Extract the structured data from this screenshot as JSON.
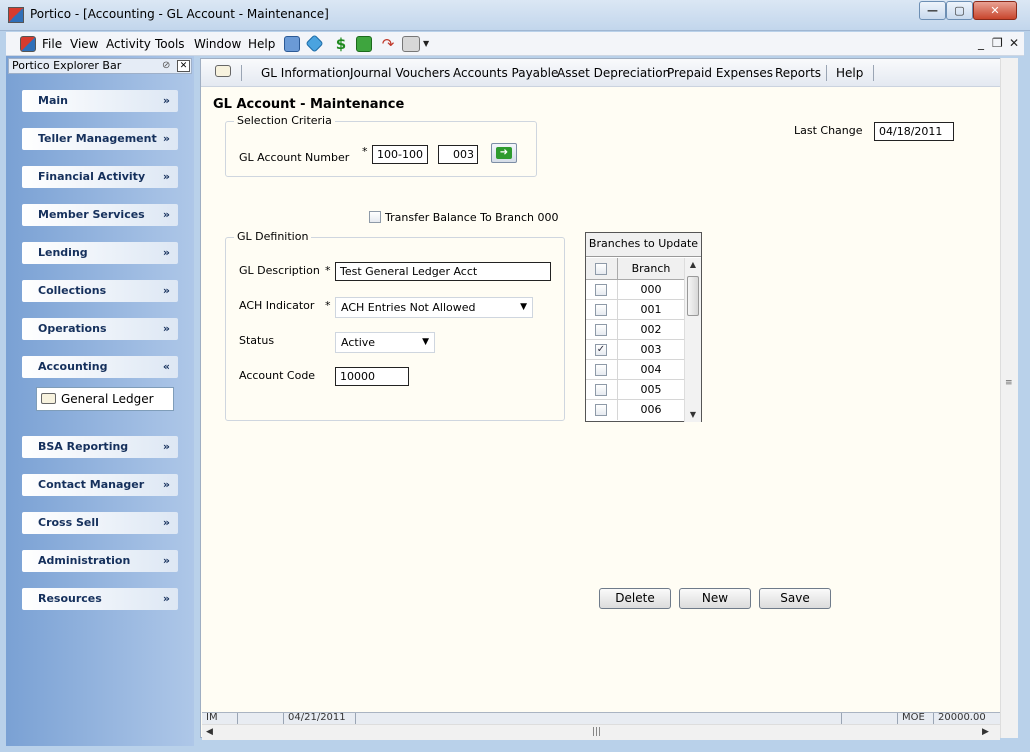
{
  "window": {
    "title": "Portico - [Accounting - GL Account - Maintenance]",
    "min": "—",
    "max": "▢",
    "close": "✕"
  },
  "menu": {
    "items": [
      "File",
      "View",
      "Activity",
      "Tools",
      "Window",
      "Help"
    ],
    "mdi_min": "_",
    "mdi_restore": "❐",
    "mdi_close": "✕"
  },
  "explorer": {
    "title": "Portico Explorer Bar",
    "sections": [
      {
        "label": "Main",
        "chev": "»"
      },
      {
        "label": "Teller Management",
        "chev": "»"
      },
      {
        "label": "Financial Activity",
        "chev": "»"
      },
      {
        "label": "Member Services",
        "chev": "»"
      },
      {
        "label": "Lending",
        "chev": "»"
      },
      {
        "label": "Collections",
        "chev": "»"
      },
      {
        "label": "Operations",
        "chev": "»"
      },
      {
        "label": "Accounting",
        "chev": "«"
      },
      {
        "label": "BSA Reporting",
        "chev": "»"
      },
      {
        "label": "Contact Manager",
        "chev": "»"
      },
      {
        "label": "Cross Sell",
        "chev": "»"
      },
      {
        "label": "Administration",
        "chev": "»"
      },
      {
        "label": "Resources",
        "chev": "»"
      }
    ],
    "accounting_item": "General Ledger"
  },
  "subnav": {
    "items": [
      "GL Information",
      "Journal Vouchers",
      "Accounts Payable",
      "Asset Depreciation",
      "Prepaid Expenses",
      "Reports",
      "Help"
    ]
  },
  "page": {
    "title": "GL Account - Maintenance",
    "selection_legend": "Selection Criteria",
    "gl_account_label": "GL Account Number",
    "gl_account_number": "100-100",
    "gl_account_suffix": "003",
    "last_change_label": "Last Change",
    "last_change_value": "04/18/2011",
    "transfer_label": "Transfer Balance To Branch 000",
    "definition_legend": "GL Definition",
    "description_label": "GL Description",
    "description_value": "Test General Ledger Acct",
    "ach_label": "ACH Indicator",
    "ach_value": "ACH Entries Not Allowed",
    "status_label": "Status",
    "status_value": "Active",
    "account_code_label": "Account Code",
    "account_code_value": "10000",
    "required_mark": "*"
  },
  "branches": {
    "header": "Branches to Update",
    "column": "Branch",
    "rows": [
      {
        "branch": "000",
        "checked": false
      },
      {
        "branch": "001",
        "checked": false
      },
      {
        "branch": "002",
        "checked": false
      },
      {
        "branch": "003",
        "checked": true
      },
      {
        "branch": "004",
        "checked": false
      },
      {
        "branch": "005",
        "checked": false
      },
      {
        "branch": "006",
        "checked": false
      }
    ]
  },
  "buttons": {
    "delete": "Delete",
    "new": "New",
    "save": "Save"
  },
  "status_bar": {
    "cells": [
      "IM",
      "",
      "04/21/2011",
      "",
      "",
      "MOE",
      "20000.00"
    ]
  },
  "colors": {
    "accent": "#2f6fb8",
    "go_button": "#2e9b2e",
    "panel_bg": "#fffdf4"
  }
}
